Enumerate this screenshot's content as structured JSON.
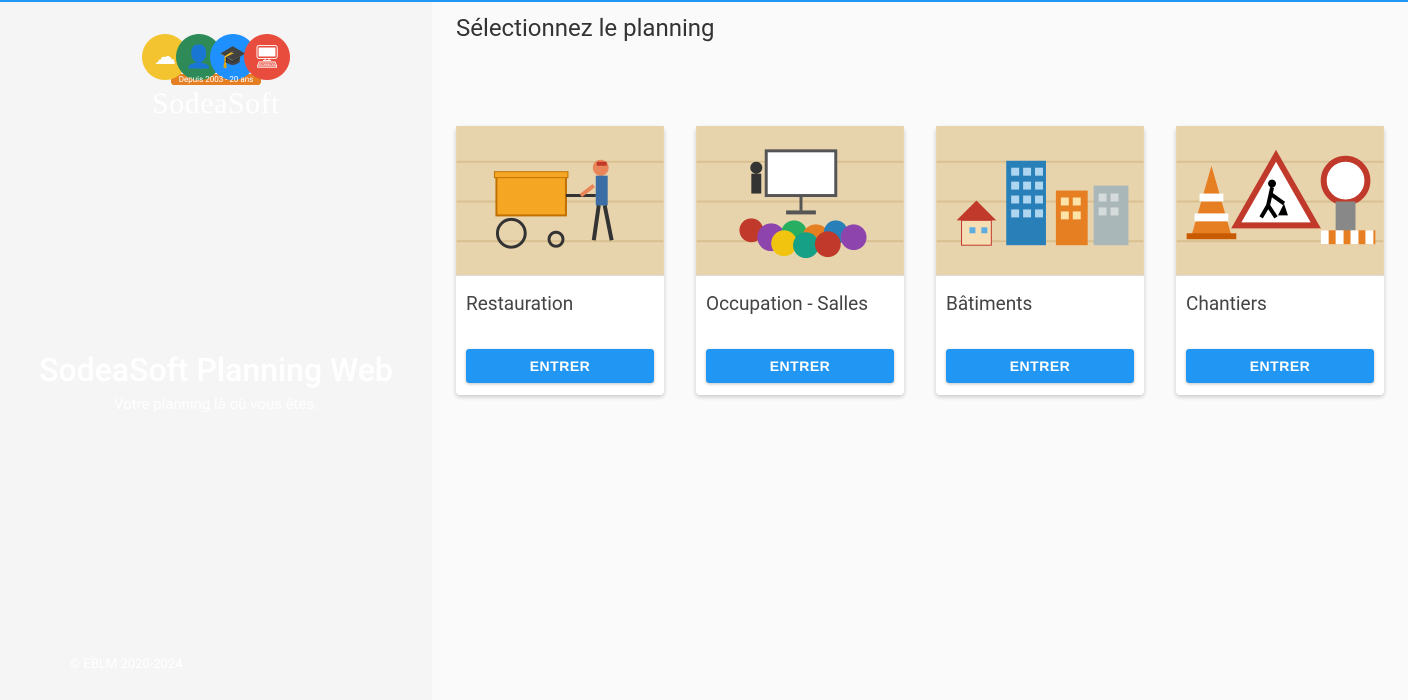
{
  "brand": {
    "name": "SodeaSoft",
    "badge": "Depuis 2003 - 20 ans"
  },
  "hero": {
    "title": "SodeaSoft Planning Web",
    "subtitle": "Votre planning là où vous êtes."
  },
  "footer": {
    "copyright": "© EBLM 2020-2024",
    "link": ""
  },
  "page": {
    "title": "Sélectionnez le planning"
  },
  "cards": [
    {
      "title": "Restauration",
      "button": "ENTRER"
    },
    {
      "title": "Occupation - Salles",
      "button": "ENTRER"
    },
    {
      "title": "Bâtiments",
      "button": "ENTRER"
    },
    {
      "title": "Chantiers",
      "button": "ENTRER"
    }
  ]
}
